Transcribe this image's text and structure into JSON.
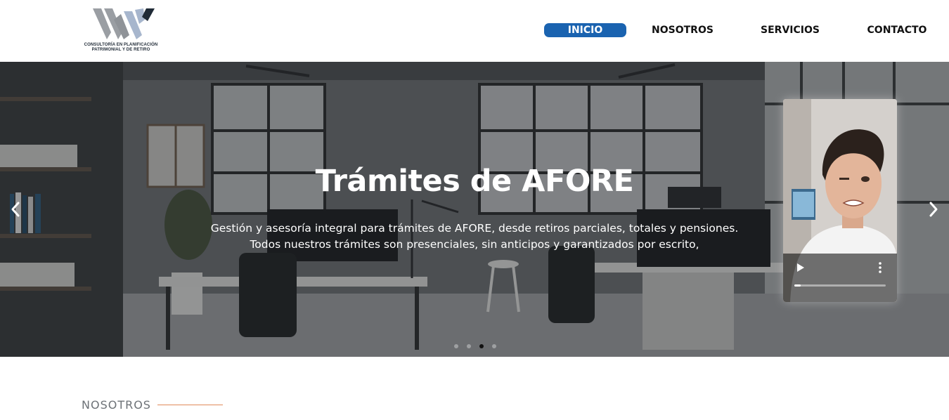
{
  "logo": {
    "line1": "CONSULTORÍA EN PLANIFICACIÓN",
    "line2": "PATRIMONIAL Y DE RETIRO"
  },
  "nav": {
    "items": [
      {
        "label": "INICIO",
        "active": true
      },
      {
        "label": "NOSOTROS",
        "active": false
      },
      {
        "label": "SERVICIOS",
        "active": false
      },
      {
        "label": "CONTACTO",
        "active": false
      }
    ]
  },
  "hero": {
    "title": "Trámites de AFORE",
    "desc_line1": "Gestión y asesoría integral para trámites de AFORE, desde retiros parciales, totales y pensiones.",
    "desc_line2": "Todos nuestros trámites son presenciales, sin anticipos y garantizados por escrito,",
    "slide_count": 4,
    "active_slide": 3
  },
  "video": {
    "progress": 0.07
  },
  "section": {
    "label": "NOSOTROS"
  },
  "colors": {
    "accent": "#1a63b0",
    "section_line": "#e08a5a"
  }
}
